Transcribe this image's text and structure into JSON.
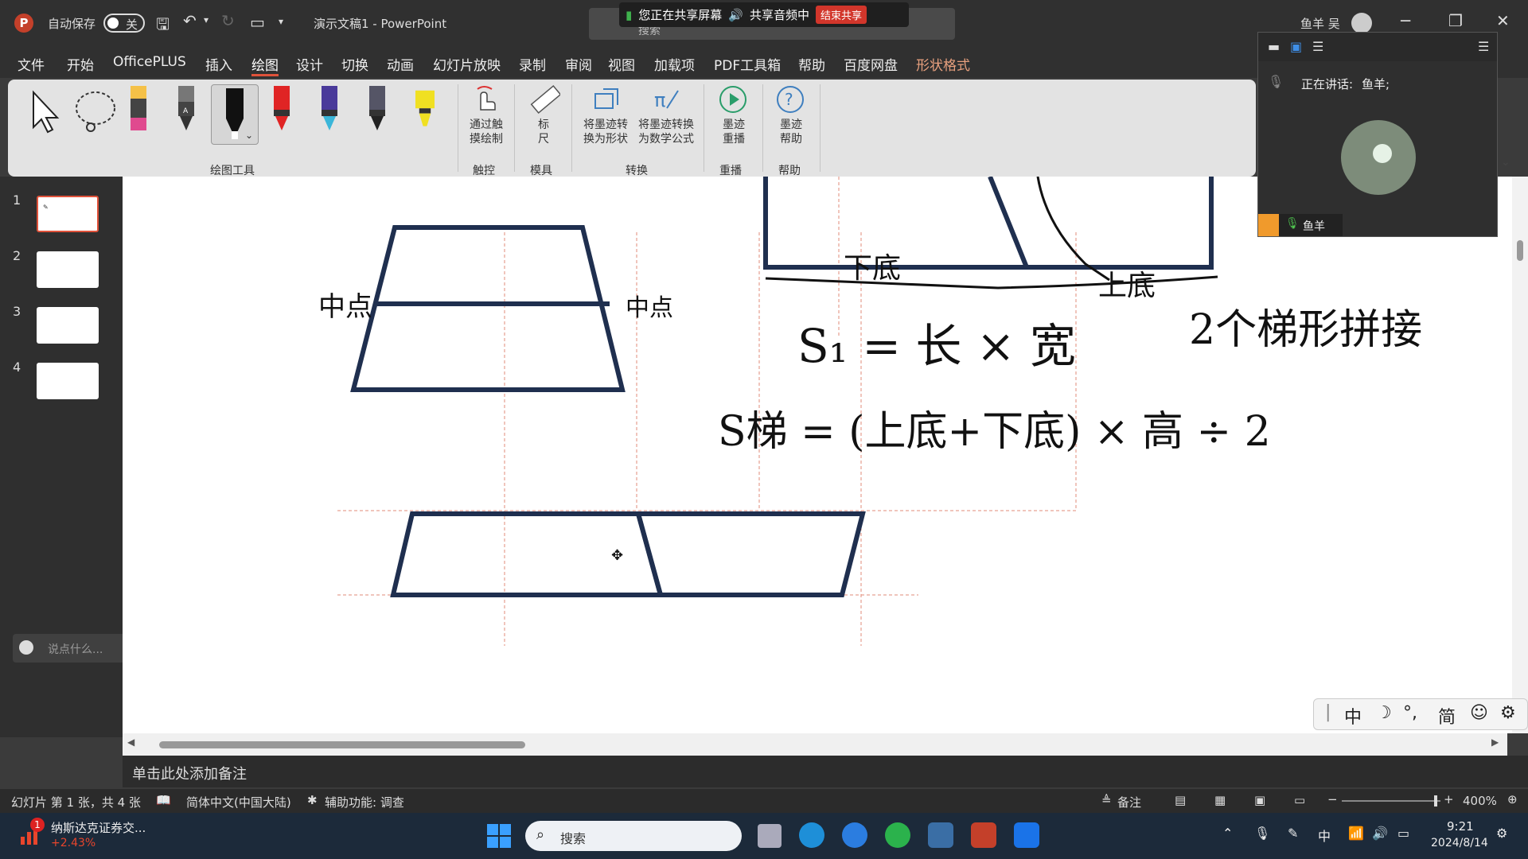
{
  "titlebar": {
    "autosave_label": "自动保存",
    "autosave_state": "关",
    "doc_title": "演示文稿1 - PowerPoint",
    "user_name": "鱼羊 吴"
  },
  "share_banner": {
    "sharing_text": "您正在共享屏幕",
    "audio_text": "共享音频中",
    "end_button": "结束共享",
    "search_placeholder": "搜索"
  },
  "menu": {
    "tabs": [
      "文件",
      "开始",
      "OfficePLUS",
      "插入",
      "绘图",
      "设计",
      "切换",
      "动画",
      "幻灯片放映",
      "录制",
      "审阅",
      "视图",
      "加载项",
      "PDF工具箱",
      "帮助",
      "百度网盘",
      "形状格式"
    ],
    "active_tab": "绘图"
  },
  "ribbon": {
    "touch_draw": "通过触\n摸绘制",
    "ruler": "标\n尺",
    "ink_to_shape": "将墨迹转\n换为形状",
    "ink_to_math": "将墨迹转换\n为数学公式",
    "ink_replay": "墨迹\n重播",
    "ink_help": "墨迹\n帮助",
    "groups": {
      "drawing_tools": "绘图工具",
      "touch": "触控",
      "stencils": "模具",
      "convert": "转换",
      "replay": "重播",
      "help": "帮助"
    }
  },
  "slides": {
    "numbers": [
      "1",
      "2",
      "3",
      "4"
    ],
    "selected": "1"
  },
  "canvas_text": {
    "handwriting_1": "中点",
    "handwriting_2": "中点",
    "handwriting_3": "下底",
    "handwriting_4": "上底",
    "formula_1": "S₁ = 长 × 宽",
    "formula_2": "S梯 = (上底+下底) × 高 ÷ 2",
    "title_hand": "2个梯形拼接"
  },
  "notes": {
    "placeholder": "单击此处添加备注"
  },
  "statusbar": {
    "slide_info": "幻灯片 第 1 张，共 4 张",
    "language": "简体中文(中国大陆)",
    "accessibility": "辅助功能: 调查",
    "notes_btn": "备注",
    "zoom": "400%"
  },
  "meeting": {
    "speaking_label": "正在讲话:",
    "speaker": "鱼羊;",
    "participant": "鱼羊"
  },
  "chat": {
    "placeholder": "说点什么..."
  },
  "ime": {
    "mode": "中",
    "simplified": "简"
  },
  "taskbar": {
    "stock_name": "纳斯达克证券交...",
    "stock_change": "+2.43%",
    "stock_badge": "1",
    "search_placeholder": "搜索",
    "ime_indicator": "中",
    "time": "9:21",
    "date": "2024/8/14"
  },
  "colors": {
    "accent": "#e0523a",
    "shape_stroke": "#1f2f4f",
    "guide_line": "#e28b7a"
  }
}
